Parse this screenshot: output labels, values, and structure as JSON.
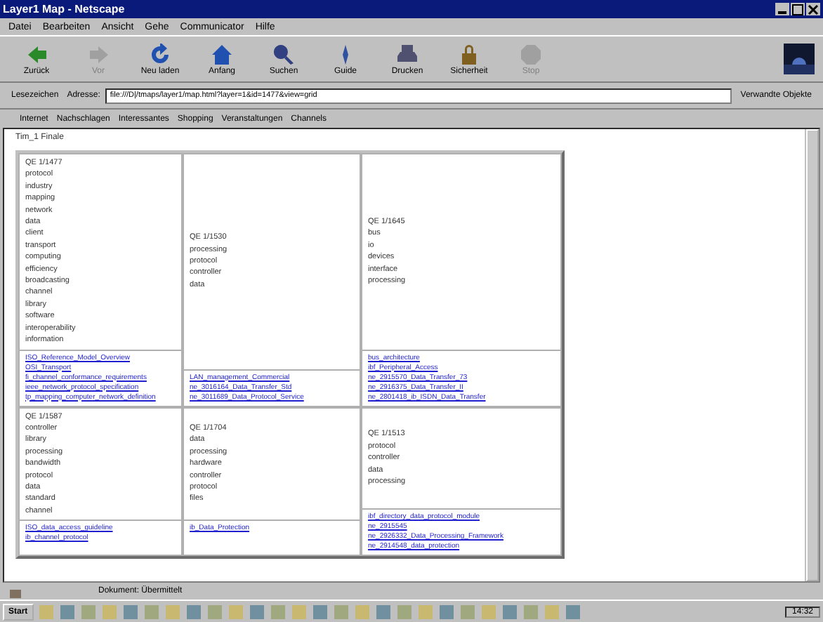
{
  "window": {
    "title": "Layer1 Map - Netscape"
  },
  "menu": [
    "Datei",
    "Bearbeiten",
    "Ansicht",
    "Gehe",
    "Communicator",
    "Hilfe"
  ],
  "toolbar": [
    {
      "label": "Zurück",
      "disabled": false
    },
    {
      "label": "Vor",
      "disabled": true
    },
    {
      "label": "Neu laden",
      "disabled": false
    },
    {
      "label": "Anfang",
      "disabled": false
    },
    {
      "label": "Suchen",
      "disabled": false
    },
    {
      "label": "Guide",
      "disabled": false
    },
    {
      "label": "Drucken",
      "disabled": false
    },
    {
      "label": "Sicherheit",
      "disabled": false
    },
    {
      "label": "Stop",
      "disabled": true
    }
  ],
  "location": {
    "bookmarks_label": "Lesezeichen",
    "address_label": "Adresse:",
    "url": "file:///D|/tmaps/layer1/map.html?layer=1&id=1477&view=grid",
    "related_label": "Verwandte Objekte"
  },
  "personal_toolbar": [
    "Internet",
    "Nachschlagen",
    "Interessantes",
    "Shopping",
    "Veranstaltungen",
    "Channels"
  ],
  "page": {
    "heading": "Tim_1 Finale",
    "cells": [
      {
        "title": "QE 1/1477",
        "terms": [
          "protocol",
          "industry",
          "mapping",
          "network",
          "data",
          "client",
          "transport",
          "computing",
          "efficiency",
          "broadcasting",
          "channel",
          "library",
          "software",
          "interoperability",
          "information"
        ],
        "links": [
          "ISO_Reference_Model_Overview",
          "OSI_Transport",
          "fi_channel_conformance_requirements",
          "ieee_network_protocol_specification",
          "tp_mapping_computer_network_definition"
        ]
      },
      {
        "title": "QE 1/1530",
        "terms": [
          "processing",
          "protocol",
          "controller",
          "data"
        ],
        "links": [
          "LAN_management_Commercial",
          "ne_3016164_Data_Transfer_Std",
          "ne_3011689_Data_Protocol_Service"
        ]
      },
      {
        "title": "QE 1/1645",
        "terms": [
          "bus",
          "io",
          "devices",
          "interface",
          "processing"
        ],
        "links": [
          "bus_architecture",
          "ibf_Peripheral_Access",
          "ne_2915570_Data_Transfer_73",
          "ne_2916375_Data_Transfer_II",
          "ne_2801418_ib_ISDN_Data_Transfer"
        ]
      },
      {
        "title": "QE 1/1587",
        "terms": [
          "controller",
          "library",
          "processing",
          "bandwidth",
          "protocol",
          "data",
          "standard",
          "channel"
        ],
        "links": [
          "ISO_data_access_guideline",
          "ib_channel_protocol"
        ]
      },
      {
        "title": "QE 1/1704",
        "terms": [
          "data",
          "processing",
          "hardware",
          "controller",
          "protocol",
          "files"
        ],
        "links": [
          "ib_Data_Protection"
        ]
      },
      {
        "title": "QE 1/1513",
        "terms": [
          "protocol",
          "controller",
          "data",
          "processing"
        ],
        "links": [
          "ibf_directory_data_protocol_module",
          "ne_2915545",
          "ne_2926332_Data_Processing_Framework",
          "ne_2914548_data_protection"
        ]
      }
    ]
  },
  "status_bar": {
    "text": "Dokument: Übermittelt"
  },
  "taskbar": {
    "start_label": "Start",
    "clock": "14:32"
  }
}
